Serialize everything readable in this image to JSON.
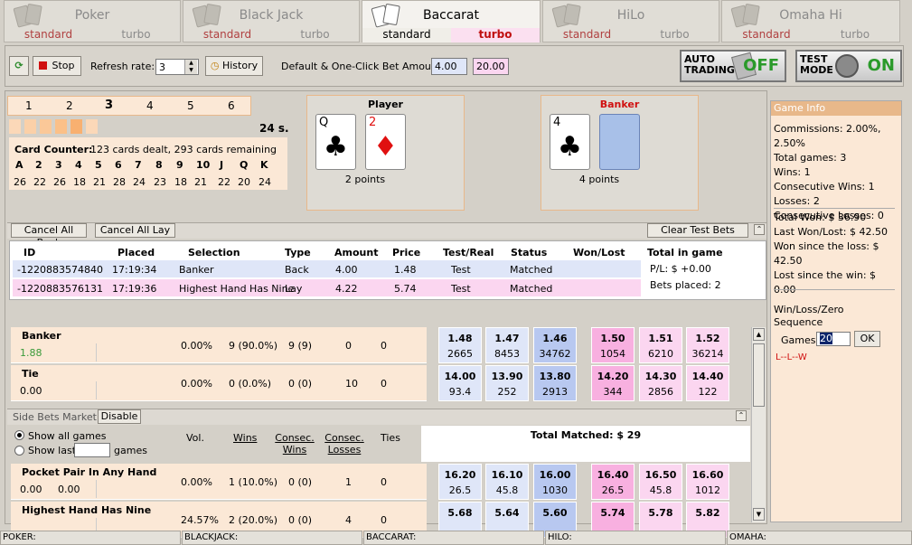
{
  "tabs": [
    {
      "name": "Poker",
      "standard": "standard",
      "turbo": "turbo"
    },
    {
      "name": "Black Jack",
      "standard": "standard",
      "turbo": "turbo"
    },
    {
      "name": "Baccarat",
      "standard": "standard",
      "turbo": "turbo"
    },
    {
      "name": "HiLo",
      "standard": "standard",
      "turbo": "turbo"
    },
    {
      "name": "Omaha Hi",
      "standard": "standard",
      "turbo": "turbo"
    }
  ],
  "toolbar": {
    "stop": "Stop",
    "refresh_label": "Refresh rate:",
    "refresh_value": "3",
    "history": "History",
    "bet_label": "Default & One-Click Bet Amounts:",
    "bet1": "4.00",
    "bet2": "20.00",
    "auto_t1": "AUTO",
    "auto_t2": "TRADING",
    "auto_state": "OFF",
    "test_t1": "TEST",
    "test_t2": "MODE",
    "test_state": "ON"
  },
  "rounds": [
    "1",
    "2",
    "3",
    "4",
    "5",
    "6"
  ],
  "timer": "24 s.",
  "counter": {
    "label": "Card Counter:",
    "summary": "123 cards dealt, 293 cards remaining",
    "ranks": [
      "A",
      "2",
      "3",
      "4",
      "5",
      "6",
      "7",
      "8",
      "9",
      "10",
      "J",
      "Q",
      "K"
    ],
    "counts": [
      "26",
      "22",
      "26",
      "18",
      "21",
      "28",
      "24",
      "23",
      "18",
      "21",
      "22",
      "20",
      "24"
    ]
  },
  "player": {
    "title": "Player",
    "points": "2 points",
    "card1_rank": "Q",
    "card1_suit": "♣",
    "card2_rank": "2",
    "card2_suit": "♦"
  },
  "banker": {
    "title": "Banker",
    "points": "4 points",
    "card1_rank": "4",
    "card1_suit": "♣"
  },
  "bets": {
    "cancel_back": "Cancel All Back",
    "cancel_lay": "Cancel All Lay",
    "clear_test": "Clear Test Bets",
    "headers": [
      "ID",
      "Placed",
      "Selection",
      "Type",
      "Amount",
      "Price",
      "Test/Real",
      "Status",
      "Won/Lost"
    ],
    "rows": [
      [
        "-1220883574840",
        "17:19:34",
        "Banker",
        "Back",
        "4.00",
        "1.48",
        "Test",
        "Matched",
        ""
      ],
      [
        "-1220883576131",
        "17:19:36",
        "Highest Hand Has Nine",
        "Lay",
        "4.22",
        "5.74",
        "Test",
        "Matched",
        ""
      ]
    ],
    "total_label": "Total in game",
    "pl": "P/L: $ +0.00",
    "placed": "Bets placed: 2"
  },
  "main_market": [
    {
      "name": "Banker",
      "value": "1.88",
      "pct": "0.00%",
      "wins": "9 (90.0%)",
      "consec": "9 (9)",
      "losses": "0",
      "ties": "0",
      "back": [
        [
          "1.48",
          "2665"
        ],
        [
          "1.47",
          "8453"
        ],
        [
          "1.46",
          "34762"
        ]
      ],
      "lay": [
        [
          "1.50",
          "1054"
        ],
        [
          "1.51",
          "6210"
        ],
        [
          "1.52",
          "36214"
        ]
      ]
    },
    {
      "name": "Tie",
      "value": "0.00",
      "pct": "0.00%",
      "wins": "0 (0.0%)",
      "consec": "0 (0)",
      "losses": "10",
      "ties": "0",
      "back": [
        [
          "14.00",
          "93.4"
        ],
        [
          "13.90",
          "252"
        ],
        [
          "13.80",
          "2913"
        ]
      ],
      "lay": [
        [
          "14.20",
          "344"
        ],
        [
          "14.30",
          "2856"
        ],
        [
          "14.40",
          "122"
        ]
      ]
    }
  ],
  "side": {
    "title": "Side Bets Market",
    "disable": "Disable",
    "show_all": "Show all games",
    "show_last": "Show last",
    "games": "games",
    "cols": [
      "Vol.",
      "Wins",
      "Consec. Wins",
      "Consec. Losses",
      "Ties"
    ],
    "total_matched": "Total Matched: $ 29",
    "rows": [
      {
        "name": "Pocket Pair In Any Hand",
        "v1": "0.00",
        "v2": "0.00",
        "pct": "0.00%",
        "wins": "1 (10.0%)",
        "consec": "0 (0)",
        "losses": "1",
        "ties": "0",
        "back": [
          [
            "16.20",
            "26.5"
          ],
          [
            "16.10",
            "45.8"
          ],
          [
            "16.00",
            "1030"
          ]
        ],
        "lay": [
          [
            "16.40",
            "26.5"
          ],
          [
            "16.50",
            "45.8"
          ],
          [
            "16.60",
            "1012"
          ]
        ]
      },
      {
        "name": "Highest Hand Has Nine",
        "v1": "",
        "v2": "",
        "pct": "24.57%",
        "wins": "2 (20.0%)",
        "consec": "0 (0)",
        "losses": "4",
        "ties": "0",
        "back": [
          [
            "5.68",
            ""
          ],
          [
            "5.64",
            ""
          ],
          [
            "5.60",
            ""
          ]
        ],
        "lay": [
          [
            "5.74",
            ""
          ],
          [
            "5.78",
            ""
          ],
          [
            "5.82",
            ""
          ]
        ]
      }
    ]
  },
  "info": {
    "title": "Game Info",
    "commissions": "Commissions: 2.00%, 2.50%",
    "total_games": "Total games: 3",
    "wins": "Wins: 1",
    "consec_wins": "Consecutive Wins: 1",
    "losses": "Losses: 2",
    "consec_losses": "Consecutive Losses: 0",
    "total_won": "Total Won: $ 36.90",
    "last": "Last Won/Lost: $ 42.50",
    "since_loss": "Won since the loss: $ 42.50",
    "since_win": "Lost since the win: $ 0.00",
    "seq_title": "Win/Loss/Zero Sequence",
    "games_label": "Games:",
    "games_value": "20",
    "ok": "OK",
    "sequence": "L--L--W"
  },
  "status": [
    "POKER:",
    "BLACKJACK:",
    "BACCARAT:",
    "HILO:",
    "OMAHA:"
  ]
}
